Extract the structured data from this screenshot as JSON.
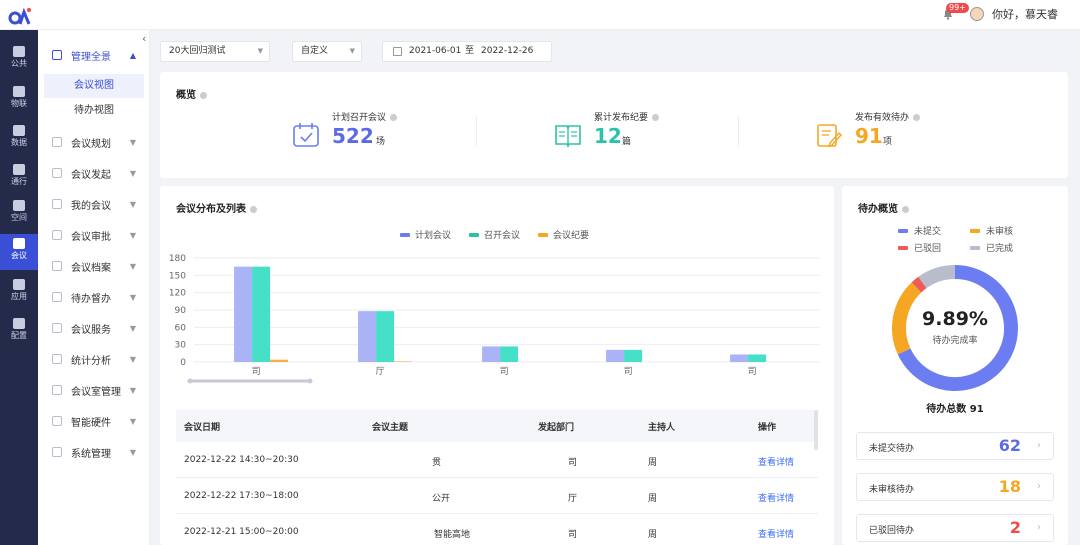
{
  "header": {
    "notifications_badge": "99+",
    "greeting": "你好，慕天睿"
  },
  "iconbar": {
    "items": [
      {
        "label": "公共",
        "icon": "building-icon"
      },
      {
        "label": "物联",
        "icon": "iot-icon"
      },
      {
        "label": "数据",
        "icon": "bar-chart-icon"
      },
      {
        "label": "通行",
        "icon": "pass-icon"
      },
      {
        "label": "空间",
        "icon": "cube-icon"
      },
      {
        "label": "会议",
        "icon": "people-icon"
      },
      {
        "label": "应用",
        "icon": "apps-grid-icon"
      },
      {
        "label": "配置",
        "icon": "gear-icon"
      }
    ],
    "active": "会议"
  },
  "subnav": {
    "group": "管理全景",
    "subitems": [
      "会议视图",
      "待办视图"
    ],
    "active_subitem": "会议视图",
    "items": [
      "会议规划",
      "会议发起",
      "我的会议",
      "会议审批",
      "会议档案",
      "待办督办",
      "会议服务",
      "统计分析",
      "会议室管理",
      "智能硬件",
      "系统管理"
    ]
  },
  "filter": {
    "project": "20大回归测试",
    "range_type": "自定义",
    "date_start": "2021-06-01",
    "date_sep": "至",
    "date_end": "2022-12-26"
  },
  "overview": {
    "title": "概览",
    "stats": [
      {
        "label": "计划召开会议",
        "value": "522",
        "unit": "场",
        "color": "#5b6be8"
      },
      {
        "label": "累计发布纪要",
        "value": "12",
        "unit": "篇",
        "color": "#2bc3a8"
      },
      {
        "label": "发布有效待办",
        "value": "91",
        "unit": "项",
        "color": "#f5a623"
      }
    ]
  },
  "distribution": {
    "title": "会议分布及列表",
    "table": {
      "headers": [
        "会议日期",
        "会议主题",
        "发起部门",
        "主持人",
        "操作"
      ],
      "rows": [
        {
          "date": "2022-12-22 14:30~20:30",
          "topic": "贯",
          "dept": "司",
          "host": "周",
          "action": "查看详情"
        },
        {
          "date": "2022-12-22 17:30~18:00",
          "topic": "公开",
          "dept": "厅",
          "host": "周",
          "action": "查看详情"
        },
        {
          "date": "2022-12-21 15:00~20:00",
          "topic": "智能高地",
          "dept": "司",
          "host": "周",
          "action": "查看详情"
        }
      ]
    }
  },
  "chart_data": {
    "type": "bar",
    "categories": [
      "司",
      "厅",
      "司",
      "司",
      "司"
    ],
    "series": [
      {
        "name": "计划会议",
        "color": "#a9b3f5",
        "values": [
          165,
          88,
          27,
          21,
          13
        ]
      },
      {
        "name": "召开会议",
        "color": "#46dfc8",
        "values": [
          165,
          88,
          27,
          21,
          13
        ]
      },
      {
        "name": "会议纪要",
        "color": "#f5b04a",
        "values": [
          4,
          1,
          0,
          0,
          0
        ]
      }
    ],
    "yticks": [
      "0",
      "30",
      "60",
      "90",
      "120",
      "150",
      "180"
    ],
    "ylim": [
      0,
      180
    ],
    "legend": "top-center",
    "grid": true
  },
  "todo": {
    "title": "待办概览",
    "legend": [
      {
        "name": "未提交",
        "color": "#6b7df0"
      },
      {
        "name": "未审核",
        "color": "#f5a623"
      },
      {
        "name": "已驳回",
        "color": "#f05a5a"
      },
      {
        "name": "已完成",
        "color": "#b8bccb"
      }
    ],
    "donut": [
      62,
      18,
      2,
      9
    ],
    "percent": "9.89%",
    "percent_label": "待办完成率",
    "total_label": "待办总数 91",
    "rows": [
      {
        "label": "未提交待办",
        "value": "62",
        "color": "#5b6be8"
      },
      {
        "label": "未审核待办",
        "value": "18",
        "color": "#f5a623"
      },
      {
        "label": "已驳回待办",
        "value": "2",
        "color": "#f04a4a"
      }
    ]
  }
}
